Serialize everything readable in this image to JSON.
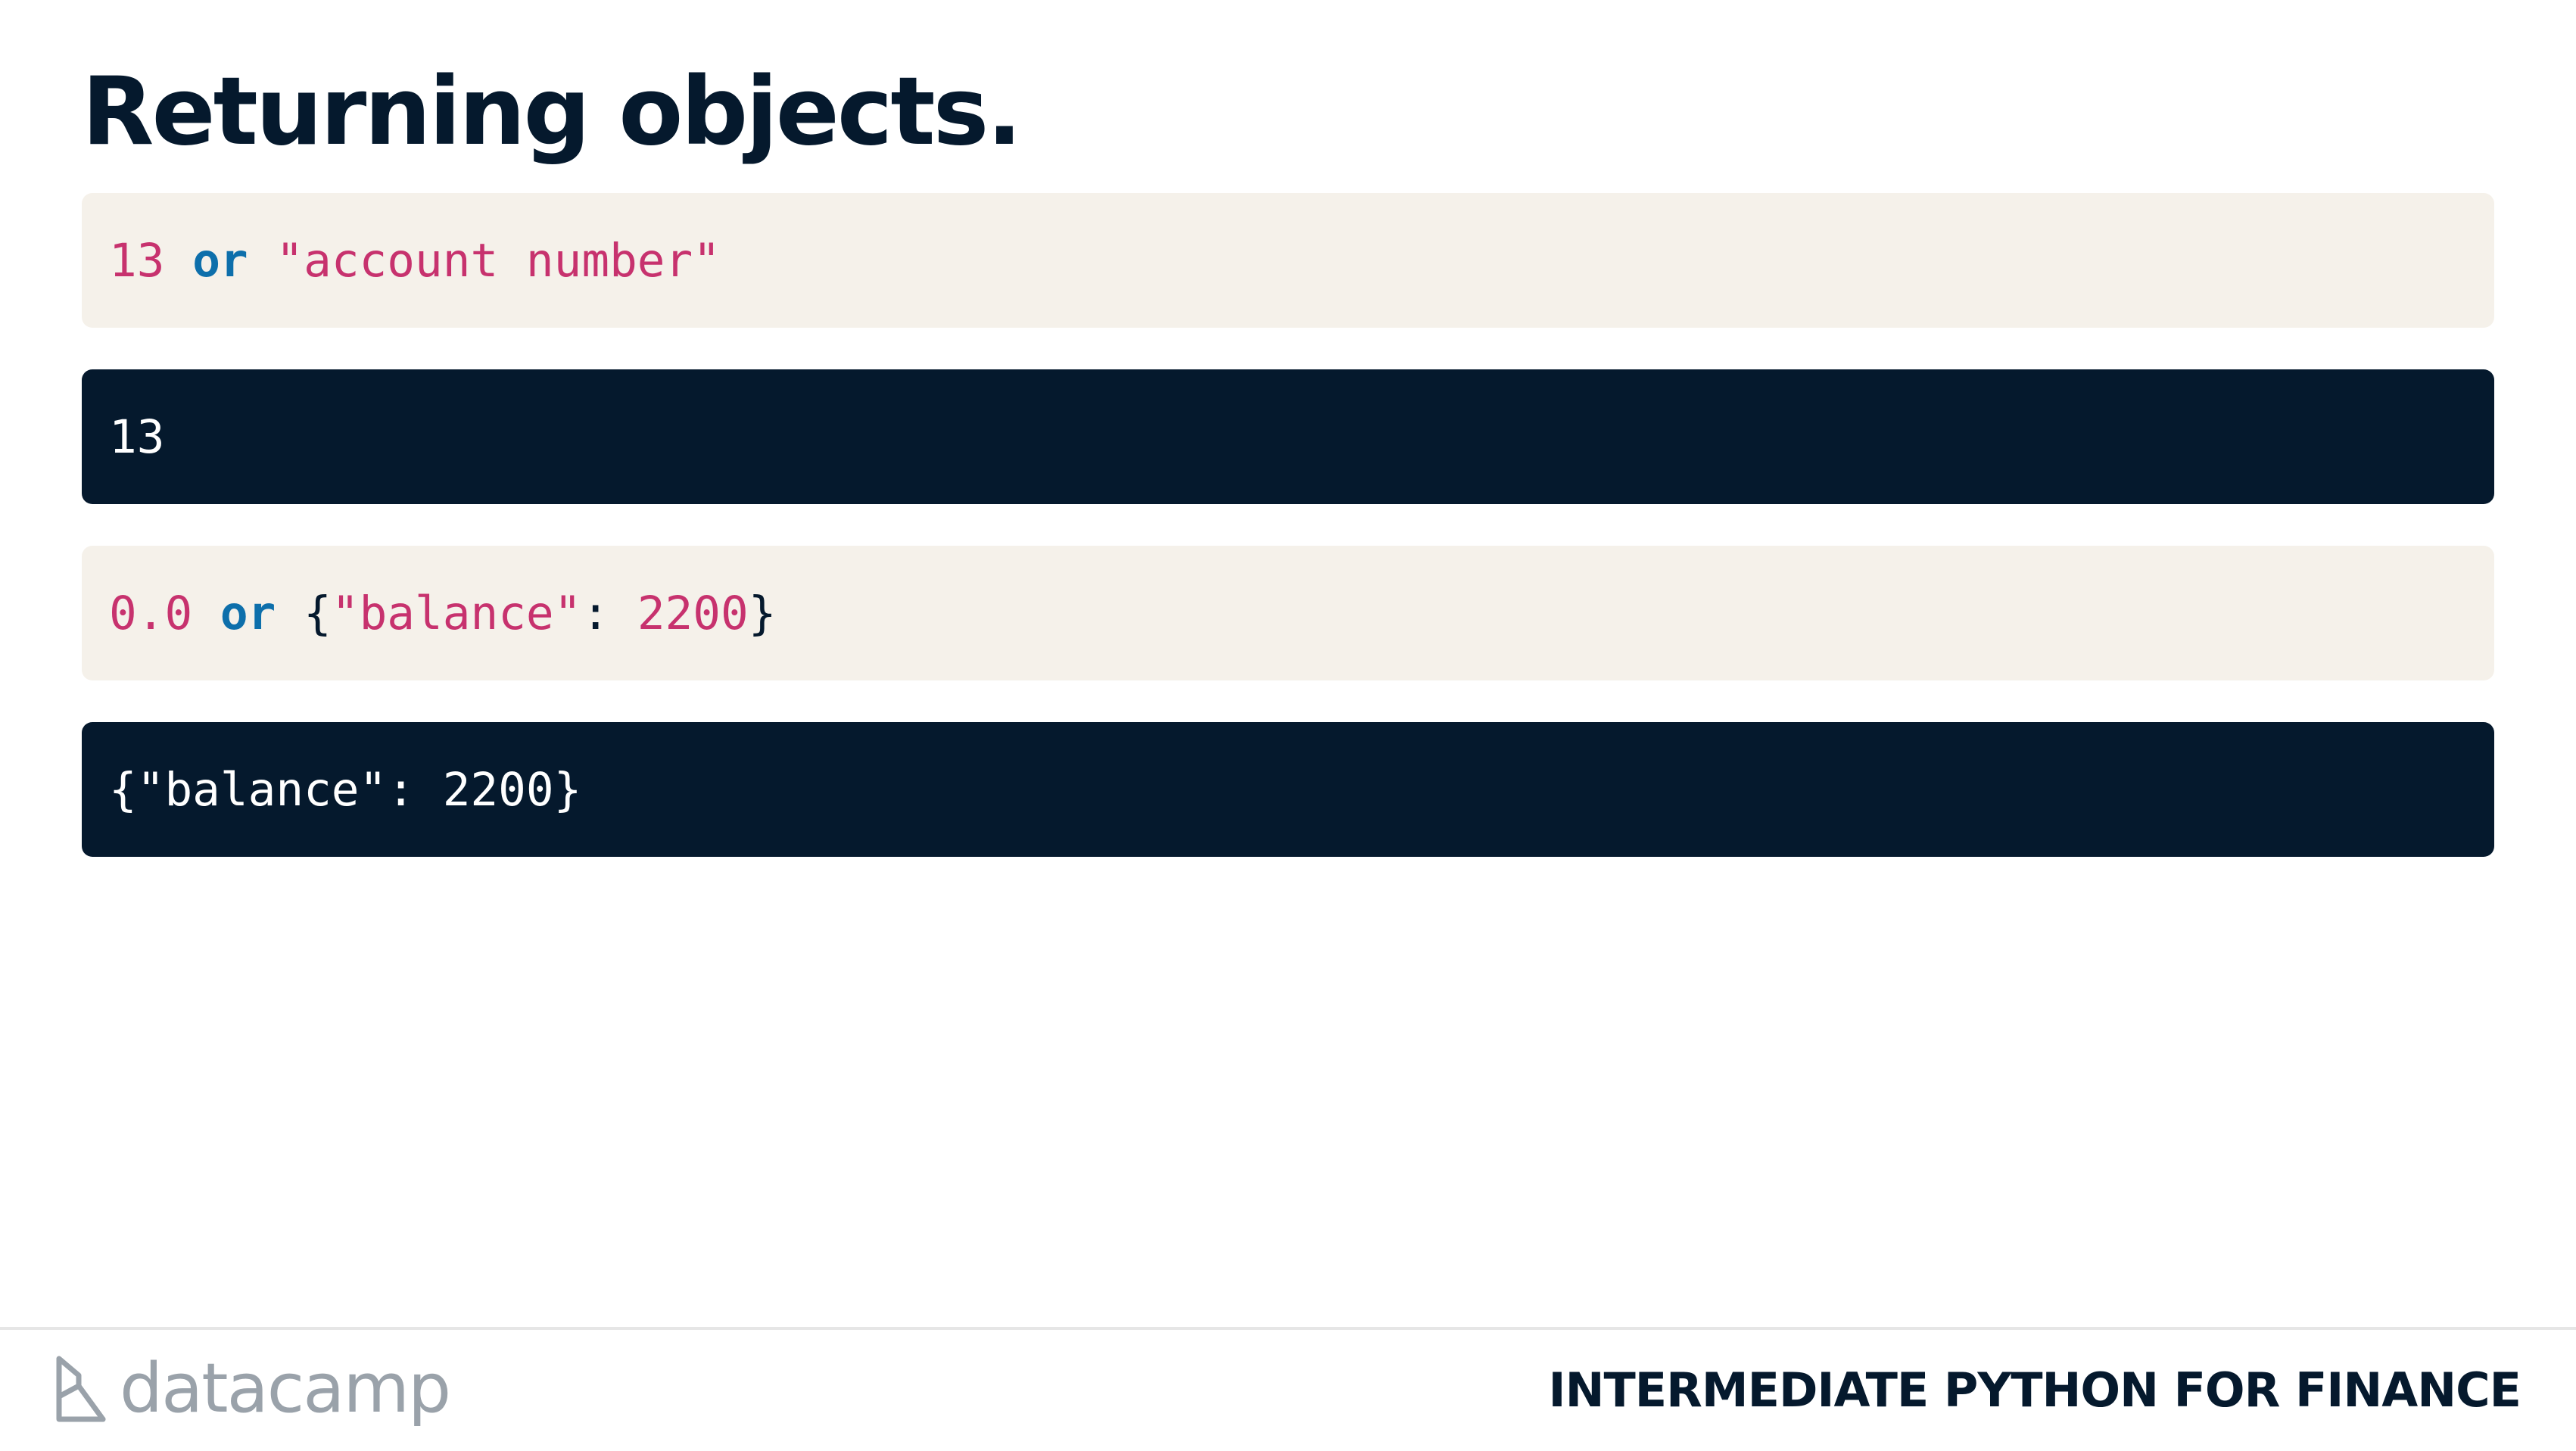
{
  "title": "Returning objects.",
  "blocks": [
    {
      "kind": "input",
      "tokens": [
        {
          "text": "13",
          "role": "number"
        },
        {
          "text": " ",
          "role": "space"
        },
        {
          "text": "or",
          "role": "keyword"
        },
        {
          "text": " ",
          "role": "space"
        },
        {
          "text": "\"account number\"",
          "role": "string"
        }
      ]
    },
    {
      "kind": "output",
      "text": "13"
    },
    {
      "kind": "input",
      "tokens": [
        {
          "text": "0.0",
          "role": "number"
        },
        {
          "text": " ",
          "role": "space"
        },
        {
          "text": "or",
          "role": "keyword"
        },
        {
          "text": " ",
          "role": "space"
        },
        {
          "text": "{",
          "role": "punct"
        },
        {
          "text": "\"balance\"",
          "role": "string"
        },
        {
          "text": ": ",
          "role": "punct"
        },
        {
          "text": "2200",
          "role": "number"
        },
        {
          "text": "}",
          "role": "punct"
        }
      ]
    },
    {
      "kind": "output",
      "text": "{\"balance\": 2200}"
    }
  ],
  "footer": {
    "logo_text": "datacamp",
    "logo_icon": "datacamp-logo-icon",
    "course_title": "INTERMEDIATE PYTHON FOR FINANCE"
  },
  "colors": {
    "title": "#05192d",
    "input_background": "#f5f1ea",
    "output_background": "#05192d",
    "number_string": "#c7326e",
    "keyword": "#0d6fab",
    "logo": "#9aa2aa"
  }
}
